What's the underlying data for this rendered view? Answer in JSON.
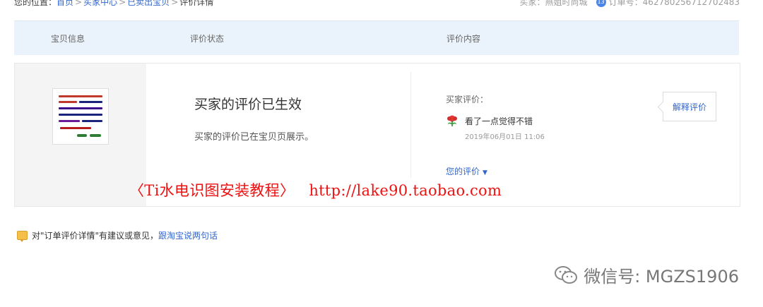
{
  "breadcrumb": {
    "prefix": "您的位置：",
    "items": [
      "首页",
      "买家中心",
      "已卖出宝贝"
    ],
    "separator": ">",
    "current": "评价详情"
  },
  "order_meta": {
    "buyer": "买家：燕姐时尚城",
    "badge": "13",
    "order_no": "订单号：462780256712702483"
  },
  "table_header": {
    "col1": "宝贝信息",
    "col2": "评价状态",
    "col3": "评价内容"
  },
  "status": {
    "title": "买家的评价已生效",
    "description": "买家的评价已在宝贝页展示。"
  },
  "review": {
    "label": "买家评价：",
    "text": "看了一点觉得不错",
    "date": "2019年06月01日 11:06",
    "icon": "flower-icon",
    "your_review_label": "您的评价"
  },
  "explain_button_label": "解释评价",
  "watermark": {
    "title": "〈Ti水电识图安装教程〉",
    "url": "http://lake90.taobao.com"
  },
  "feedback": {
    "text": "对\"订单评价详情\"有建议或意见，",
    "link": "跟淘宝说两句话"
  },
  "wechat": {
    "text": "微信号: MGZS1906"
  },
  "colors": {
    "link": "#3366cc",
    "header_bg": "#eaf3fb",
    "watermark": "#ee1111"
  }
}
